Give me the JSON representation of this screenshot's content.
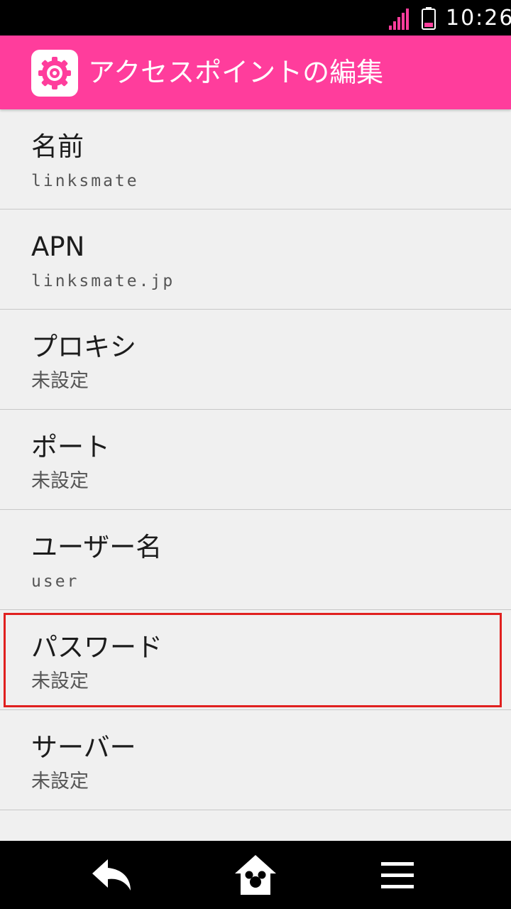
{
  "status_bar": {
    "time": "10:26",
    "signal_icon": "cell-signal-icon",
    "battery_icon": "battery-low-icon",
    "accent_color": "#ff3d9c"
  },
  "app_bar": {
    "title": "アクセスポイントの編集",
    "icon": "settings-gear-icon",
    "background_color": "#ff3d9c"
  },
  "items": [
    {
      "title": "名前",
      "value": "linksmate"
    },
    {
      "title": "APN",
      "value": "linksmate.jp"
    },
    {
      "title": "プロキシ",
      "value": "未設定"
    },
    {
      "title": "ポート",
      "value": "未設定"
    },
    {
      "title": "ユーザー名",
      "value": "user"
    },
    {
      "title": "パスワード",
      "value": "未設定"
    },
    {
      "title": "サーバー",
      "value": "未設定"
    }
  ],
  "highlight_color": "#e0201f",
  "nav_bar": {
    "back_icon": "back-arrow-icon",
    "home_icon": "home-mouse-icon",
    "menu_icon": "menu-icon"
  }
}
